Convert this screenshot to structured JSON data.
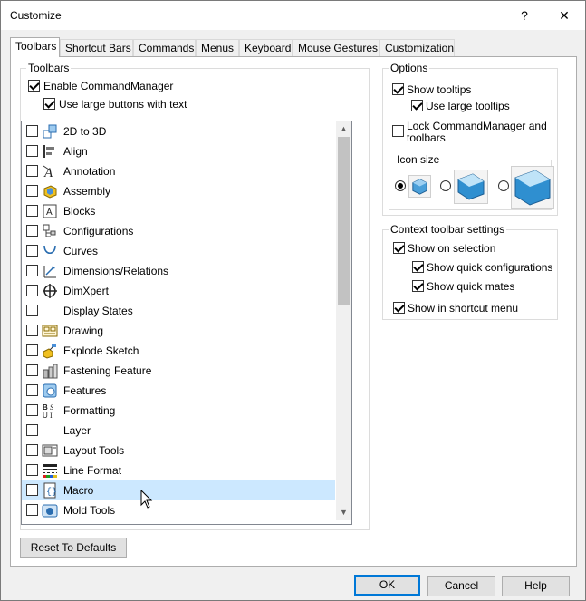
{
  "window": {
    "title": "Customize",
    "help_glyph": "?",
    "close_glyph": "✕"
  },
  "tabs": [
    {
      "label": "Toolbars",
      "active": true
    },
    {
      "label": "Shortcut Bars"
    },
    {
      "label": "Commands"
    },
    {
      "label": "Menus"
    },
    {
      "label": "Keyboard"
    },
    {
      "label": "Mouse Gestures"
    },
    {
      "label": "Customization"
    }
  ],
  "toolbars_group": {
    "title": "Toolbars",
    "enable_commandmanager": {
      "label": "Enable CommandManager",
      "checked": true
    },
    "use_large_buttons": {
      "label": "Use large buttons with text",
      "checked": true
    },
    "items": [
      {
        "label": "2D to 3D",
        "checked": false,
        "icon": "2d-to-3d-icon"
      },
      {
        "label": "Align",
        "checked": false,
        "icon": "align-icon"
      },
      {
        "label": "Annotation",
        "checked": false,
        "icon": "annotation-icon"
      },
      {
        "label": "Assembly",
        "checked": false,
        "icon": "assembly-icon"
      },
      {
        "label": "Blocks",
        "checked": false,
        "icon": "blocks-icon"
      },
      {
        "label": "Configurations",
        "checked": false,
        "icon": "configurations-icon"
      },
      {
        "label": "Curves",
        "checked": false,
        "icon": "curves-icon"
      },
      {
        "label": "Dimensions/Relations",
        "checked": false,
        "icon": "dimensions-icon"
      },
      {
        "label": "DimXpert",
        "checked": false,
        "icon": "dimxpert-icon"
      },
      {
        "label": "Display States",
        "checked": false,
        "icon": ""
      },
      {
        "label": "Drawing",
        "checked": false,
        "icon": "drawing-icon"
      },
      {
        "label": "Explode Sketch",
        "checked": false,
        "icon": "explode-sketch-icon"
      },
      {
        "label": "Fastening Feature",
        "checked": false,
        "icon": "fastening-feature-icon"
      },
      {
        "label": "Features",
        "checked": false,
        "icon": "features-icon"
      },
      {
        "label": "Formatting",
        "checked": false,
        "icon": "formatting-icon"
      },
      {
        "label": "Layer",
        "checked": false,
        "icon": ""
      },
      {
        "label": "Layout Tools",
        "checked": false,
        "icon": "layout-tools-icon"
      },
      {
        "label": "Line Format",
        "checked": false,
        "icon": "line-format-icon"
      },
      {
        "label": "Macro",
        "checked": false,
        "icon": "macro-icon",
        "selected": true
      },
      {
        "label": "Mold Tools",
        "checked": false,
        "icon": "mold-tools-icon"
      }
    ]
  },
  "options_group": {
    "title": "Options",
    "show_tooltips": {
      "label": "Show tooltips",
      "checked": true
    },
    "use_large_tooltips": {
      "label": "Use large tooltips",
      "checked": true
    },
    "lock_commandmanager": {
      "label_line1": "Lock CommandManager and",
      "label_line2": "toolbars",
      "checked": false
    },
    "icon_size": {
      "title": "Icon size",
      "selected": "small"
    }
  },
  "context_group": {
    "title": "Context toolbar settings",
    "show_on_selection": {
      "label": "Show on selection",
      "checked": true
    },
    "show_quick_configurations": {
      "label": "Show quick configurations",
      "checked": true
    },
    "show_quick_mates": {
      "label": "Show quick mates",
      "checked": true
    },
    "show_in_shortcut_menu": {
      "label": "Show in shortcut menu",
      "checked": true
    }
  },
  "buttons": {
    "reset": "Reset To Defaults",
    "ok": "OK",
    "cancel": "Cancel",
    "help": "Help"
  }
}
